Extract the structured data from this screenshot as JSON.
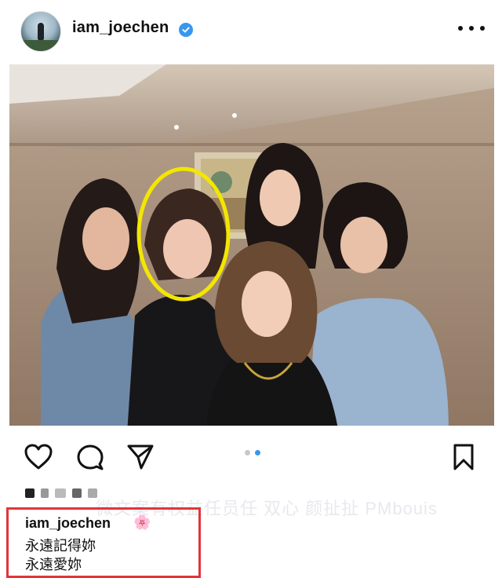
{
  "post": {
    "username": "iam_joechen",
    "verified": true,
    "image_count": 2,
    "active_image_index": 1
  },
  "caption": {
    "username": "iam_joechen",
    "emoji": "🌸",
    "line1": "永遠記得妳",
    "line2": "永遠愛妳"
  },
  "watermark": "微文案有权益任员任 双心 颜扯扯 PMbouis",
  "colors": {
    "accent": "#3797f0",
    "highlight_circle": "#f3e600",
    "caption_box": "#e3343a"
  },
  "icons": {
    "like": "heart-icon",
    "comment": "comment-icon",
    "share": "share-icon",
    "save": "bookmark-icon",
    "more": "more-icon"
  }
}
